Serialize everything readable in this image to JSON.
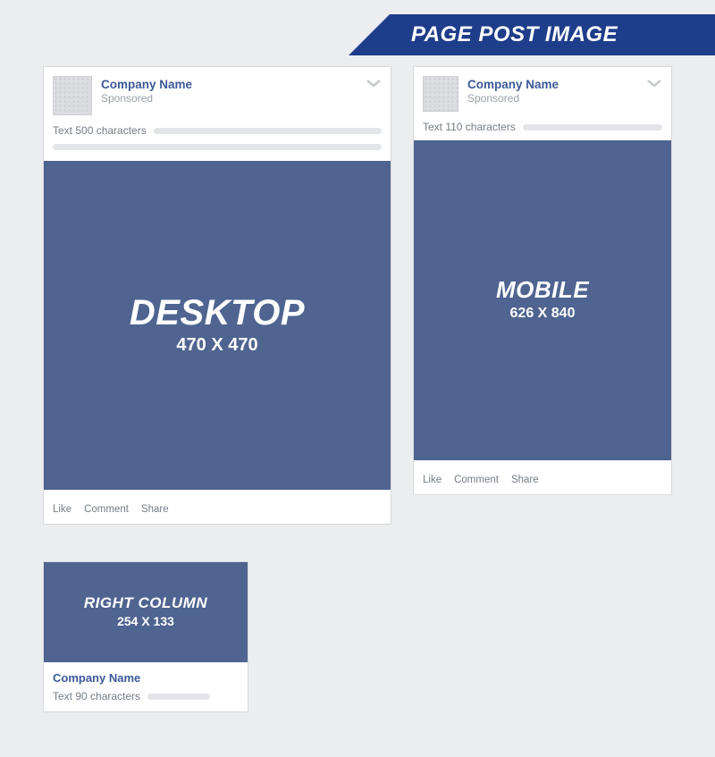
{
  "banner": {
    "title": "PAGE POST IMAGE"
  },
  "actions": {
    "like": "Like",
    "comment": "Comment",
    "share": "Share"
  },
  "desktop": {
    "company": "Company Name",
    "sponsored": "Sponsored",
    "text_label": "Text 500 characters",
    "image_title": "DESKTOP",
    "image_dims": "470 X 470"
  },
  "mobile": {
    "company": "Company Name",
    "sponsored": "Sponsored",
    "text_label": "Text 110 characters",
    "image_title": "MOBILE",
    "image_dims": "626 X 840"
  },
  "right": {
    "company": "Company Name",
    "text_label": "Text 90 characters",
    "image_title": "RIGHT COLUMN",
    "image_dims": "254 X 133"
  }
}
